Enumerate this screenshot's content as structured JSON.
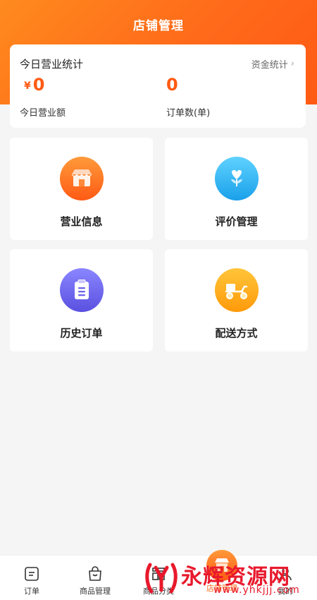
{
  "header": {
    "title": "店铺管理"
  },
  "stats": {
    "title": "今日营业统计",
    "link_label": "资金统计",
    "revenue_currency": "¥",
    "revenue_value": "0",
    "revenue_label": "今日营业额",
    "orders_value": "0",
    "orders_label": "订单数(单)"
  },
  "tiles": [
    {
      "label": "营业信息",
      "icon": "storefront-icon",
      "color": "#ff6a1a"
    },
    {
      "label": "评价管理",
      "icon": "heart-flower-icon",
      "color": "#1aa0ea"
    },
    {
      "label": "历史订单",
      "icon": "clipboard-icon",
      "color": "#5a50e0"
    },
    {
      "label": "配送方式",
      "icon": "scooter-icon",
      "color": "#ff9a0a"
    }
  ],
  "tabbar": {
    "items": [
      {
        "label": "订单",
        "icon": "order-icon"
      },
      {
        "label": "商品管理",
        "icon": "shopping-bag-icon"
      },
      {
        "label": "商品分类",
        "icon": "category-icon"
      },
      {
        "label": "店铺管理",
        "icon": "store-icon",
        "active": true
      },
      {
        "label": "我的",
        "icon": "user-icon"
      }
    ]
  },
  "watermark": {
    "text": "永辉资源网",
    "url": "www.yhkjjj.com"
  },
  "colors": {
    "accent": "#ff6a1a",
    "background": "#f5f5f5",
    "watermark": "#e8192c"
  }
}
